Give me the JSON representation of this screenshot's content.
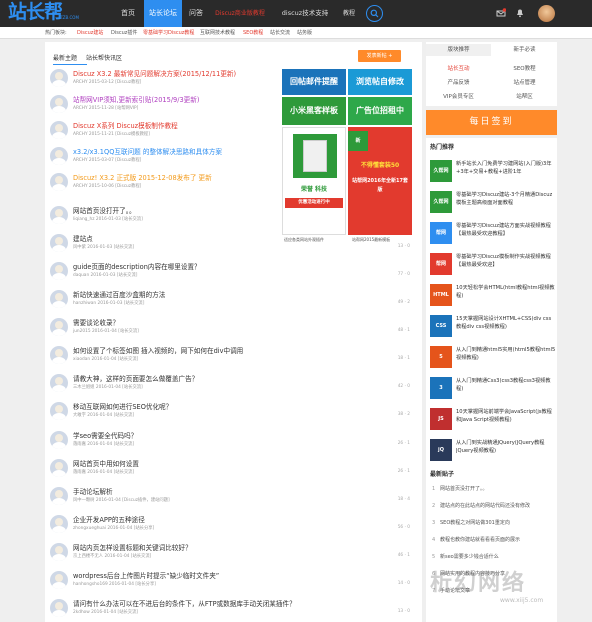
{
  "logo": {
    "text": "站长帮",
    "domain": "ZZB.COM"
  },
  "nav": {
    "items": [
      "首页",
      "站长论坛",
      "问答",
      "Discuz商业版教程",
      "discuz技术支持",
      "教程"
    ],
    "active_index": 1
  },
  "subnav": {
    "label": "热门板块:",
    "items": [
      "Discuz建站",
      "Discuz插件",
      "零基础学习Discuz教程",
      "互联网技术教程",
      "SEO教程",
      "站长交流",
      "站务版"
    ]
  },
  "main": {
    "tabs": [
      "最新主题",
      "站长帮快讯区"
    ],
    "post_button": "发表新帖 +",
    "posts": [
      {
        "title": "Discuz X3.2 最新常见问题解决方案(2015/12/11更新)",
        "meta": "ARCHY 2015-03-12 [Discuz教程]",
        "color": "red"
      },
      {
        "title": "站帮网VIP须知,更新索引贴(2015/9/3更新)",
        "meta": "ARCHY 2015-11-28 [站帮网VIP]",
        "color": "purple"
      },
      {
        "title": "Discuz X系列 Discuz模板制作教程",
        "meta": "ARCHY 2015-11-21 [Discuz模板教程]",
        "color": "red"
      },
      {
        "title": "x3.2/x3.1QQ互联问题 的整体解决思路和具体方案",
        "meta": "ARCHY 2015-03-07 [Discuz教程]",
        "color": "blue"
      },
      {
        "title": "Discuz! X3.2 正式版 2015-12-08发布了 更新",
        "meta": "ARCHY 2015-10-06 [Discuz教程]",
        "color": "orange"
      },
      {
        "title": "网站首页没打开了。。",
        "meta": "liqiang_hz 2016-01-03 [站长交流]",
        "stats": "0 · 0",
        "color": "dark"
      },
      {
        "title": "建站点",
        "meta": "风中紫 2016-01-03 [站长交流]",
        "stats": "13 · 0",
        "color": "dark"
      },
      {
        "title": "guide页面的description内容在哪里设置？",
        "meta": "daquan 2016-01-03 [站长交流]",
        "stats": "77 · 0",
        "color": "dark"
      },
      {
        "title": "新站快速通过百度沙盒期的方法",
        "meta": "hanzhiwan 2016-01-03 [站长交流]",
        "stats": "49 · 2",
        "color": "dark"
      },
      {
        "title": "需要谈论收录？",
        "meta": "jun2015 2016-01-04 [站长交流]",
        "stats": "48 · 1",
        "color": "dark"
      },
      {
        "title": "如何设置了个标签如图 插入视频的，网下如何在div中调用",
        "meta": "xiaodan 2016-01-04 [站长交流]",
        "stats": "18 · 1",
        "color": "dark"
      },
      {
        "title": "请教大神，这样的页面要怎么做覆盖广告？",
        "meta": "三木兰姐姐 2016-01-04 [站长交流]",
        "stats": "42 · 0",
        "color": "dark"
      },
      {
        "title": "移动互联网如何进行SEO优化呢？",
        "meta": "大敢字 2016-01-04 [站长交流]",
        "stats": "38 · 2",
        "color": "dark"
      },
      {
        "title": "学seo需要全代码吗？",
        "meta": "落雨嘉 2016-01-04 [站长交流]",
        "stats": "26 · 1",
        "color": "dark"
      },
      {
        "title": "网站首页中用如何设置",
        "meta": "落雨嘉 2016-01-04 [站长交流]",
        "stats": "26 · 1",
        "color": "dark"
      },
      {
        "title": "手动论坛解析",
        "meta": "风中一颗树 2016-01-04 [Discuz插件，建站问题]",
        "stats": "18 · 4",
        "color": "dark"
      },
      {
        "title": "企业开发APP的五种途径",
        "meta": "zhongxueghuai 2016-01-04 [站长分享]",
        "stats": "56 · 0",
        "color": "dark"
      },
      {
        "title": "网站内页怎样设置标题和关键词比较好？",
        "meta": "京上西楼不无人 2016-01-04 [站长交流]",
        "stats": "46 · 1",
        "color": "dark"
      },
      {
        "title": "wordpress后台上传图片时提示“缺少临时文件夹”",
        "meta": "hanhongsho169 2016-01-04 [站长分享]",
        "stats": "14 · 0",
        "color": "dark"
      },
      {
        "title": "请问有什么办法可以在不进后台的条件下，从FTP或数据库手动关闭某插件？",
        "meta": "2kdhow 2016-01-04 [站长交流]",
        "stats": "13 · 0",
        "color": "dark"
      }
    ]
  },
  "ads": {
    "a1": {
      "title": "回帖邮件提醒",
      "sub": ""
    },
    "a2": {
      "title": "浏览帖自修改",
      "sub": ""
    },
    "a3": {
      "title": "小米黑客样板",
      "sub": ""
    },
    "a4": {
      "title": "广告位招租中",
      "sub": ""
    },
    "a5": {
      "title": "荣誉 科技",
      "sub": "优惠活动进行中"
    },
    "a6": {
      "title": "不得懂套装50",
      "sub": "站帮网2016年全新17套版"
    },
    "cap1": "适应各类网站外观插件",
    "cap2": "站帮网2015最新模板"
  },
  "sidebar": {
    "tabs": [
      "版块推荐",
      "新手必读"
    ],
    "grid": [
      "站长互动",
      "SEO教程",
      "产品反馈",
      "站点管理",
      "VIP会员专区",
      "站帮区"
    ],
    "signin": "每日签到",
    "hot_title": "热门推荐",
    "hot": [
      {
        "thumb": "久帮网",
        "color": "#2e9a3a",
        "text": "新手站长入门免费学习建网站(入门版)3年+3年+交易+教程+进阶1年"
      },
      {
        "thumb": "久帮网",
        "color": "#2e9a3a",
        "text": "零基础学习Discuz建站-3个月精通Discuz模板主题高级面对面教程"
      },
      {
        "thumb": "帮网",
        "color": "#2e8ef0",
        "text": "零基础学习Discuz建站方面实战视频教程【最热最受欢迎教程】"
      },
      {
        "thumb": "帮网",
        "color": "#e23a2e",
        "text": "零基础学习Discuz模板制作实战视频教程【最热最受欢迎】"
      },
      {
        "thumb": "HTML",
        "color": "#e5541b",
        "text": "10天轻松学会HTML(html教程html视频教程)"
      },
      {
        "thumb": "CSS",
        "color": "#1b73ba",
        "text": "15天掌握网站设计XHTML+CSS(div css教程div css视频教程)"
      },
      {
        "thumb": "5",
        "color": "#e5541b",
        "text": "从入门到精通html5实用(html5教程html5视频教程)"
      },
      {
        "thumb": "3",
        "color": "#1b73ba",
        "text": "从入门到精通Css3(css3教程css3视频教程)"
      },
      {
        "thumb": "JS",
        "color": "#c02f2f",
        "text": "10天掌握网站前端学会JavaScript(js教程和Java Script视频教程)"
      },
      {
        "thumb": "jQ",
        "color": "#2a3a5a",
        "text": "从入门到实战精通JQuery(JQuery教程JQuery视频教程)"
      }
    ],
    "latest_title": "最新贴子",
    "latest": [
      "网站首页没打开了。。",
      "建站点的在此站点的网站代码还没有修改",
      "SEO教程之对网站做301重定向",
      "教程也教你建站就看看看页面的展示",
      "新seo需要多少钱合适什么",
      "网站实用的教程内容技巧分享",
      "手动论坛文章"
    ]
  },
  "watermark": {
    "text": "析幻网络",
    "url": "www.xiij5.com"
  }
}
